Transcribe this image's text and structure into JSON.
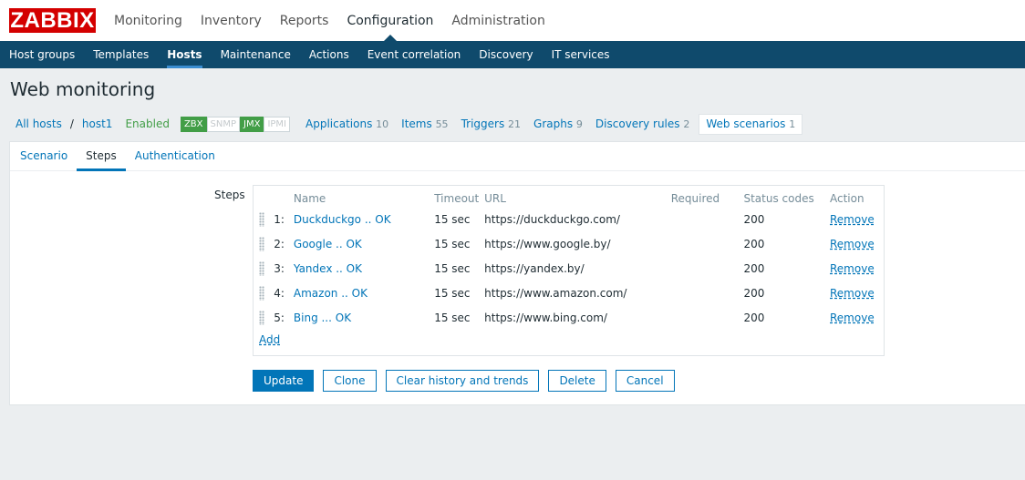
{
  "logo": "ZABBIX",
  "main_menu": [
    {
      "label": "Monitoring",
      "active": false
    },
    {
      "label": "Inventory",
      "active": false
    },
    {
      "label": "Reports",
      "active": false
    },
    {
      "label": "Configuration",
      "active": true
    },
    {
      "label": "Administration",
      "active": false
    }
  ],
  "sub_menu": [
    {
      "label": "Host groups"
    },
    {
      "label": "Templates"
    },
    {
      "label": "Hosts"
    },
    {
      "label": "Maintenance"
    },
    {
      "label": "Actions"
    },
    {
      "label": "Event correlation"
    },
    {
      "label": "Discovery"
    },
    {
      "label": "IT services"
    }
  ],
  "page_title": "Web monitoring",
  "hostnav": {
    "all_hosts": "All hosts",
    "separator": "/",
    "host": "host1",
    "status": "Enabled",
    "badges": [
      {
        "label": "ZBX",
        "on": true
      },
      {
        "label": "SNMP",
        "on": false
      },
      {
        "label": "JMX",
        "on": true
      },
      {
        "label": "IPMI",
        "on": false
      }
    ],
    "links": [
      {
        "label": "Applications",
        "count": "10"
      },
      {
        "label": "Items",
        "count": "55"
      },
      {
        "label": "Triggers",
        "count": "21"
      },
      {
        "label": "Graphs",
        "count": "9"
      },
      {
        "label": "Discovery rules",
        "count": "2"
      },
      {
        "label": "Web scenarios",
        "count": "1"
      }
    ]
  },
  "tabs": [
    {
      "label": "Scenario"
    },
    {
      "label": "Steps"
    },
    {
      "label": "Authentication"
    }
  ],
  "steps_label": "Steps",
  "columns": [
    "Name",
    "Timeout",
    "URL",
    "Required",
    "Status codes",
    "Action"
  ],
  "steps": [
    {
      "num": "1:",
      "name": "Duckduckgo .. OK",
      "timeout": "15 sec",
      "url": "https://duckduckgo.com/",
      "required": "",
      "status": "200",
      "action": "Remove"
    },
    {
      "num": "2:",
      "name": "Google .. OK",
      "timeout": "15 sec",
      "url": "https://www.google.by/",
      "required": "",
      "status": "200",
      "action": "Remove"
    },
    {
      "num": "3:",
      "name": "Yandex .. OK",
      "timeout": "15 sec",
      "url": "https://yandex.by/",
      "required": "",
      "status": "200",
      "action": "Remove"
    },
    {
      "num": "4:",
      "name": "Amazon .. OK",
      "timeout": "15 sec",
      "url": "https://www.amazon.com/",
      "required": "",
      "status": "200",
      "action": "Remove"
    },
    {
      "num": "5:",
      "name": "Bing ... OK",
      "timeout": "15 sec",
      "url": "https://www.bing.com/",
      "required": "",
      "status": "200",
      "action": "Remove"
    }
  ],
  "add_label": "Add",
  "buttons": {
    "update": "Update",
    "clone": "Clone",
    "clear": "Clear history and trends",
    "delete": "Delete",
    "cancel": "Cancel"
  }
}
